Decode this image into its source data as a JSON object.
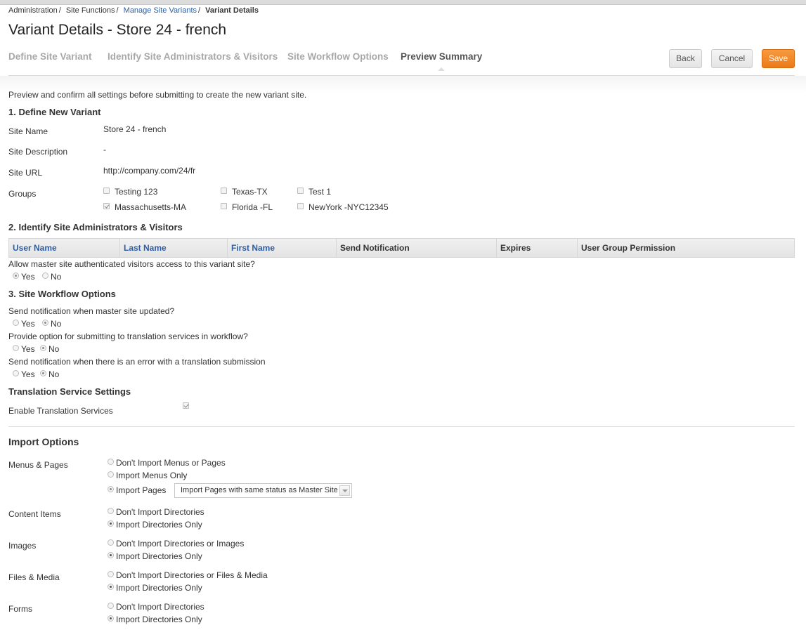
{
  "breadcrumb": {
    "items": [
      "Administration",
      "Site Functions",
      "Manage Site Variants"
    ],
    "current": "Variant Details"
  },
  "page_title": "Variant Details - Store 24 - french",
  "tabs": [
    "Define Site Variant",
    "Identify Site Administrators & Visitors",
    "Site Workflow Options",
    "Preview Summary"
  ],
  "buttons": {
    "back": "Back",
    "cancel": "Cancel",
    "save": "Save"
  },
  "intro": "Preview and confirm all settings before submitting to create the new variant site.",
  "section1": {
    "title": "1. Define New Variant",
    "site_name_label": "Site Name",
    "site_name": "Store 24 - french",
    "site_desc_label": "Site Description",
    "site_desc": "-",
    "site_url_label": "Site URL",
    "site_url": "http://company.com/24/fr",
    "groups_label": "Groups",
    "groups": [
      {
        "label": "Testing 123",
        "checked": false
      },
      {
        "label": "Texas-TX",
        "checked": false
      },
      {
        "label": "Test 1",
        "checked": false
      },
      {
        "label": "Massachusetts-MA",
        "checked": true
      },
      {
        "label": "Florida -FL",
        "checked": false
      },
      {
        "label": "NewYork -NYC12345",
        "checked": false
      }
    ]
  },
  "section2": {
    "title": "2. Identify Site Administrators & Visitors",
    "columns": [
      "User Name",
      "Last Name",
      "First Name",
      "Send Notification",
      "Expires",
      "User Group Permission"
    ],
    "allow_question": "Allow master site authenticated visitors access to this variant site?",
    "yes": "Yes",
    "no": "No"
  },
  "section3": {
    "title": "3. Site Workflow Options",
    "q1": "Send notification when master site updated?",
    "q2": "Provide option for submitting to translation services in workflow?",
    "q3": "Send notification when there is an error with a translation submission",
    "yes": "Yes",
    "no": "No"
  },
  "translation": {
    "title": "Translation Service Settings",
    "enable_label": "Enable Translation Services"
  },
  "import": {
    "title": "Import Options",
    "menus_label": "Menus & Pages",
    "menus_opt1": "Don't Import Menus or Pages",
    "menus_opt2": "Import Menus Only",
    "menus_opt3": "Import Pages",
    "pages_select": "Import Pages with same status as Master Site",
    "content_label": "Content Items",
    "content_opt1": "Don't Import Directories",
    "content_opt2": "Import Directories Only",
    "images_label": "Images",
    "images_opt1": "Don't Import Directories or Images",
    "images_opt2": "Import Directories Only",
    "files_label": "Files & Media",
    "files_opt1": "Don't Import Directories or Files & Media",
    "files_opt2": "Import Directories Only",
    "forms_label": "Forms",
    "forms_opt1": "Don't Import Directories",
    "forms_opt2": "Import Directories Only"
  }
}
